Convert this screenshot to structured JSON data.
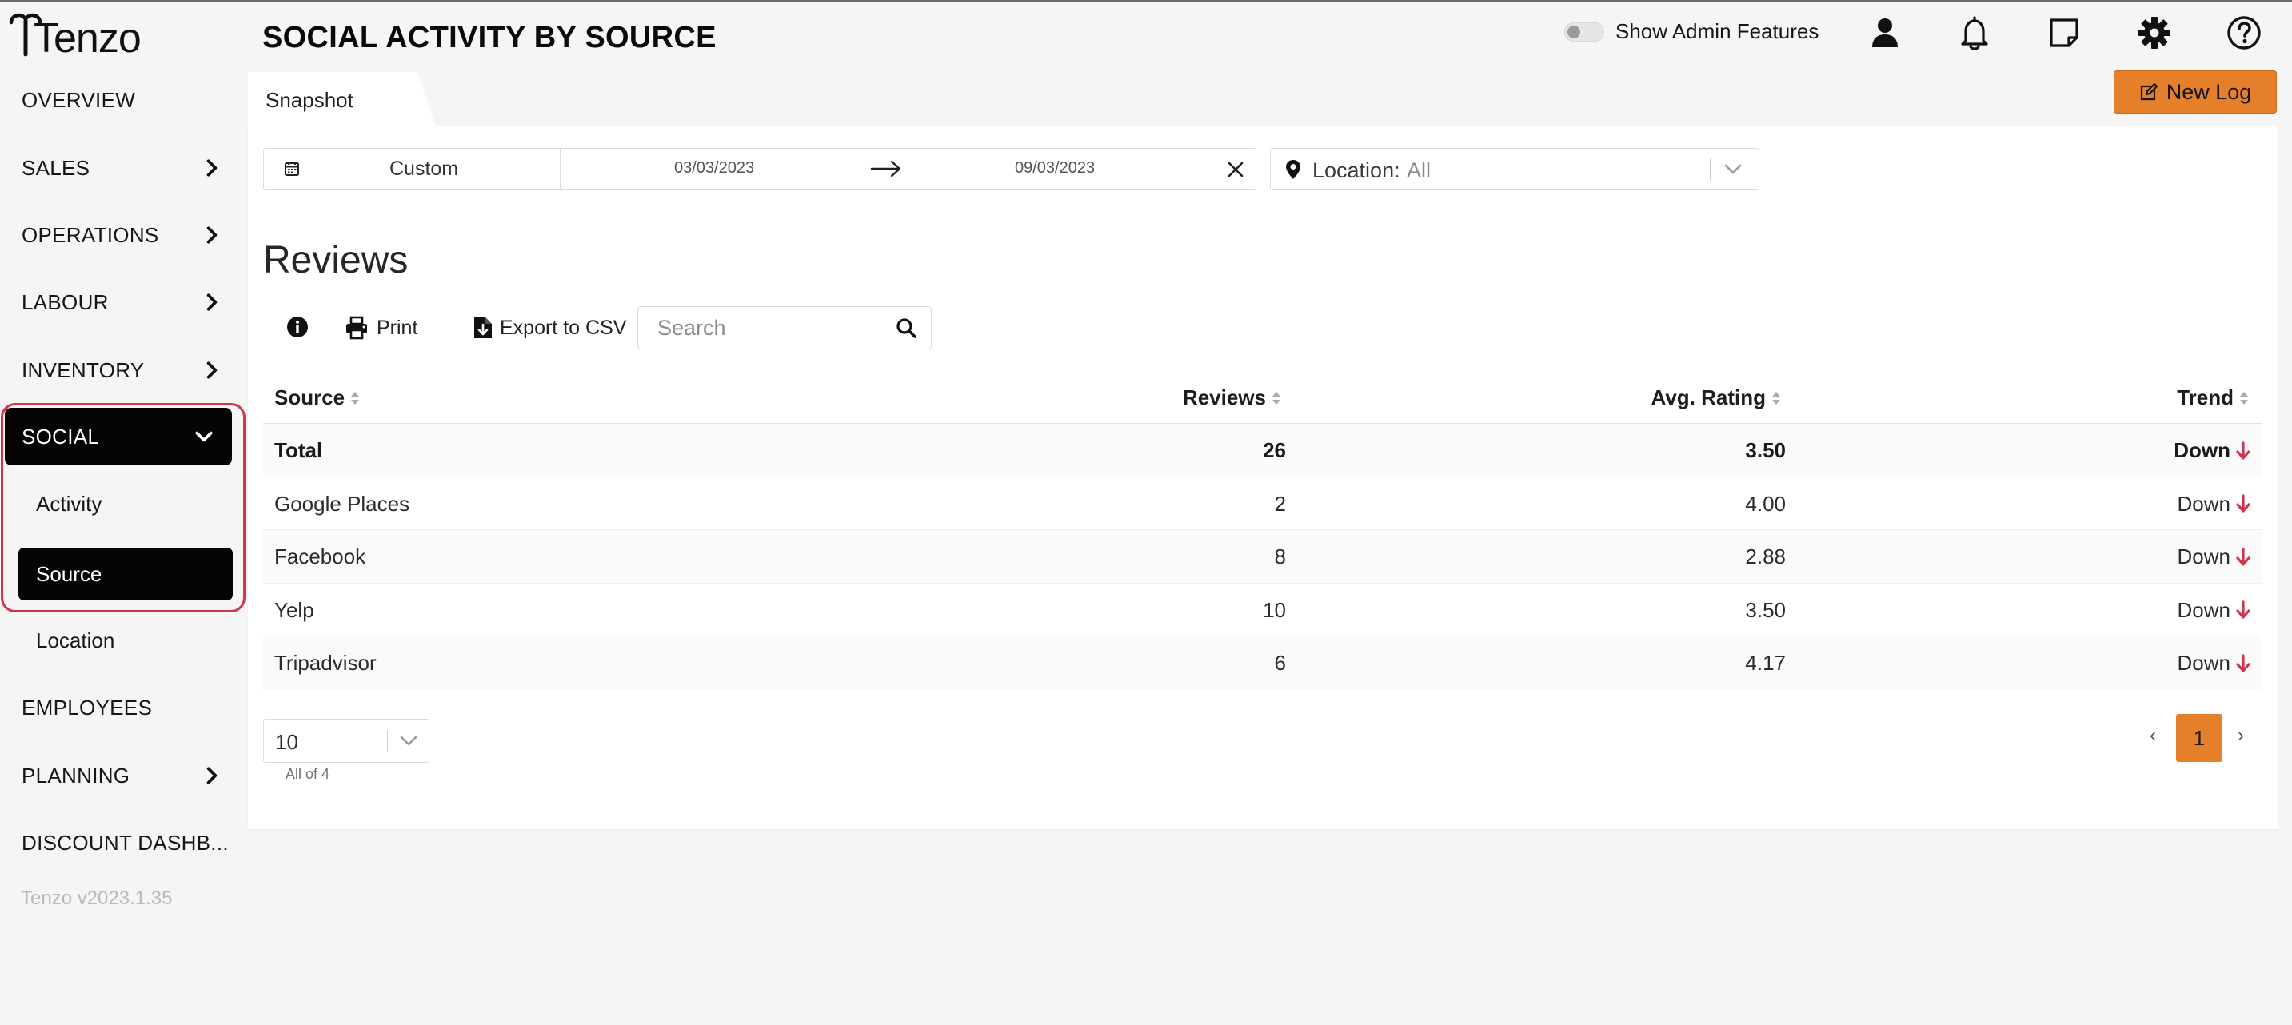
{
  "app": {
    "logo_text": "Tenzo",
    "version": "Tenzo v2023.1.35"
  },
  "sidebar": {
    "items": [
      {
        "label": "OVERVIEW",
        "has_children": false
      },
      {
        "label": "SALES",
        "has_children": true
      },
      {
        "label": "OPERATIONS",
        "has_children": true
      },
      {
        "label": "LABOUR",
        "has_children": true
      },
      {
        "label": "INVENTORY",
        "has_children": true
      },
      {
        "label": "SOCIAL",
        "has_children": true,
        "expanded": true,
        "children": [
          {
            "label": "Activity",
            "selected": false
          },
          {
            "label": "Source",
            "selected": true
          },
          {
            "label": "Location",
            "selected": false
          }
        ]
      },
      {
        "label": "EMPLOYEES",
        "has_children": false
      },
      {
        "label": "PLANNING",
        "has_children": true
      },
      {
        "label": "DISCOUNT DASHB...",
        "has_children": false
      }
    ]
  },
  "header": {
    "title": "SOCIAL ACTIVITY BY SOURCE",
    "admin_toggle": {
      "label": "Show Admin Features",
      "on": false
    },
    "icons": [
      "user-icon",
      "bell-icon",
      "note-icon",
      "gear-icon",
      "help-icon"
    ],
    "new_log_label": "New Log"
  },
  "tabs": [
    {
      "label": "Snapshot",
      "active": true
    }
  ],
  "filters": {
    "date_preset": "Custom",
    "date_start": "03/03/2023",
    "date_end": "09/03/2023",
    "location_label": "Location:",
    "location_value": "All"
  },
  "section": {
    "title": "Reviews",
    "print_label": "Print",
    "export_label": "Export to CSV",
    "search_placeholder": "Search"
  },
  "table": {
    "columns": [
      "Source",
      "Reviews",
      "Avg. Rating",
      "Trend"
    ],
    "rows": [
      {
        "source": "Total",
        "reviews": "26",
        "rating": "3.50",
        "trend": "Down",
        "is_total": true
      },
      {
        "source": "Google Places",
        "reviews": "2",
        "rating": "4.00",
        "trend": "Down"
      },
      {
        "source": "Facebook",
        "reviews": "8",
        "rating": "2.88",
        "trend": "Down"
      },
      {
        "source": "Yelp",
        "reviews": "10",
        "rating": "3.50",
        "trend": "Down"
      },
      {
        "source": "Tripadvisor",
        "reviews": "6",
        "rating": "4.17",
        "trend": "Down"
      }
    ]
  },
  "pagination": {
    "page_size": "10",
    "count_label": "All of 4",
    "prev": "‹",
    "current": "1",
    "next": "›"
  },
  "colors": {
    "accent": "#e57f2a",
    "active_nav": "#050505",
    "highlight_border": "#d0354d",
    "trend_down": "#d0354d"
  }
}
